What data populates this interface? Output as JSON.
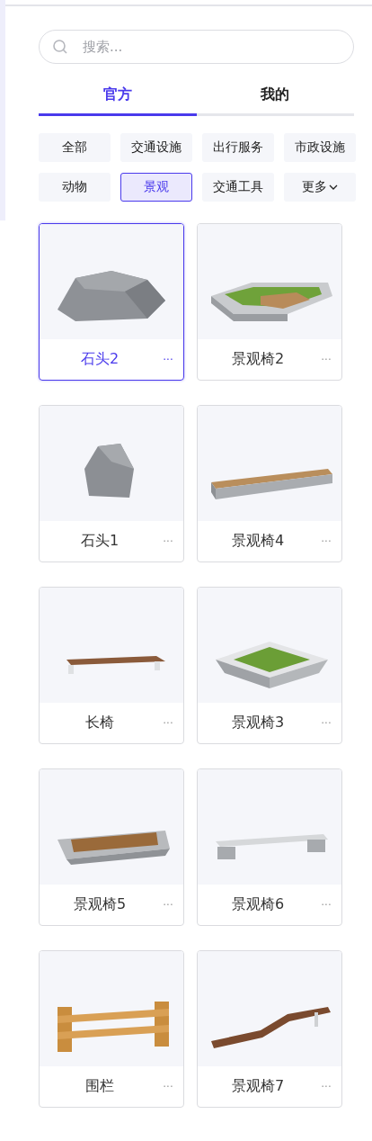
{
  "search": {
    "placeholder": "搜索..."
  },
  "tabs": [
    {
      "label": "官方",
      "selected": true
    },
    {
      "label": "我的",
      "selected": false
    }
  ],
  "filters": [
    {
      "label": "全部",
      "selected": false,
      "kind": "plain"
    },
    {
      "label": "交通设施",
      "selected": false,
      "kind": "plain"
    },
    {
      "label": "出行服务",
      "selected": false,
      "kind": "plain"
    },
    {
      "label": "市政设施",
      "selected": false,
      "kind": "plain"
    },
    {
      "label": "动物",
      "selected": false,
      "kind": "plain"
    },
    {
      "label": "景观",
      "selected": true,
      "kind": "plain"
    },
    {
      "label": "交通工具",
      "selected": false,
      "kind": "plain"
    },
    {
      "label": "更多",
      "selected": false,
      "kind": "dropdown"
    }
  ],
  "items": [
    {
      "name": "石头2",
      "selected": true,
      "more": "···"
    },
    {
      "name": "景观椅2",
      "selected": false,
      "more": "···"
    },
    {
      "name": "石头1",
      "selected": false,
      "more": "···"
    },
    {
      "name": "景观椅4",
      "selected": false,
      "more": "···"
    },
    {
      "name": "长椅",
      "selected": false,
      "more": "···"
    },
    {
      "name": "景观椅3",
      "selected": false,
      "more": "···"
    },
    {
      "name": "景观椅5",
      "selected": false,
      "more": "···"
    },
    {
      "name": "景观椅6",
      "selected": false,
      "more": "···"
    },
    {
      "name": "围栏",
      "selected": false,
      "more": "···"
    },
    {
      "name": "景观椅7",
      "selected": false,
      "more": "···"
    }
  ]
}
